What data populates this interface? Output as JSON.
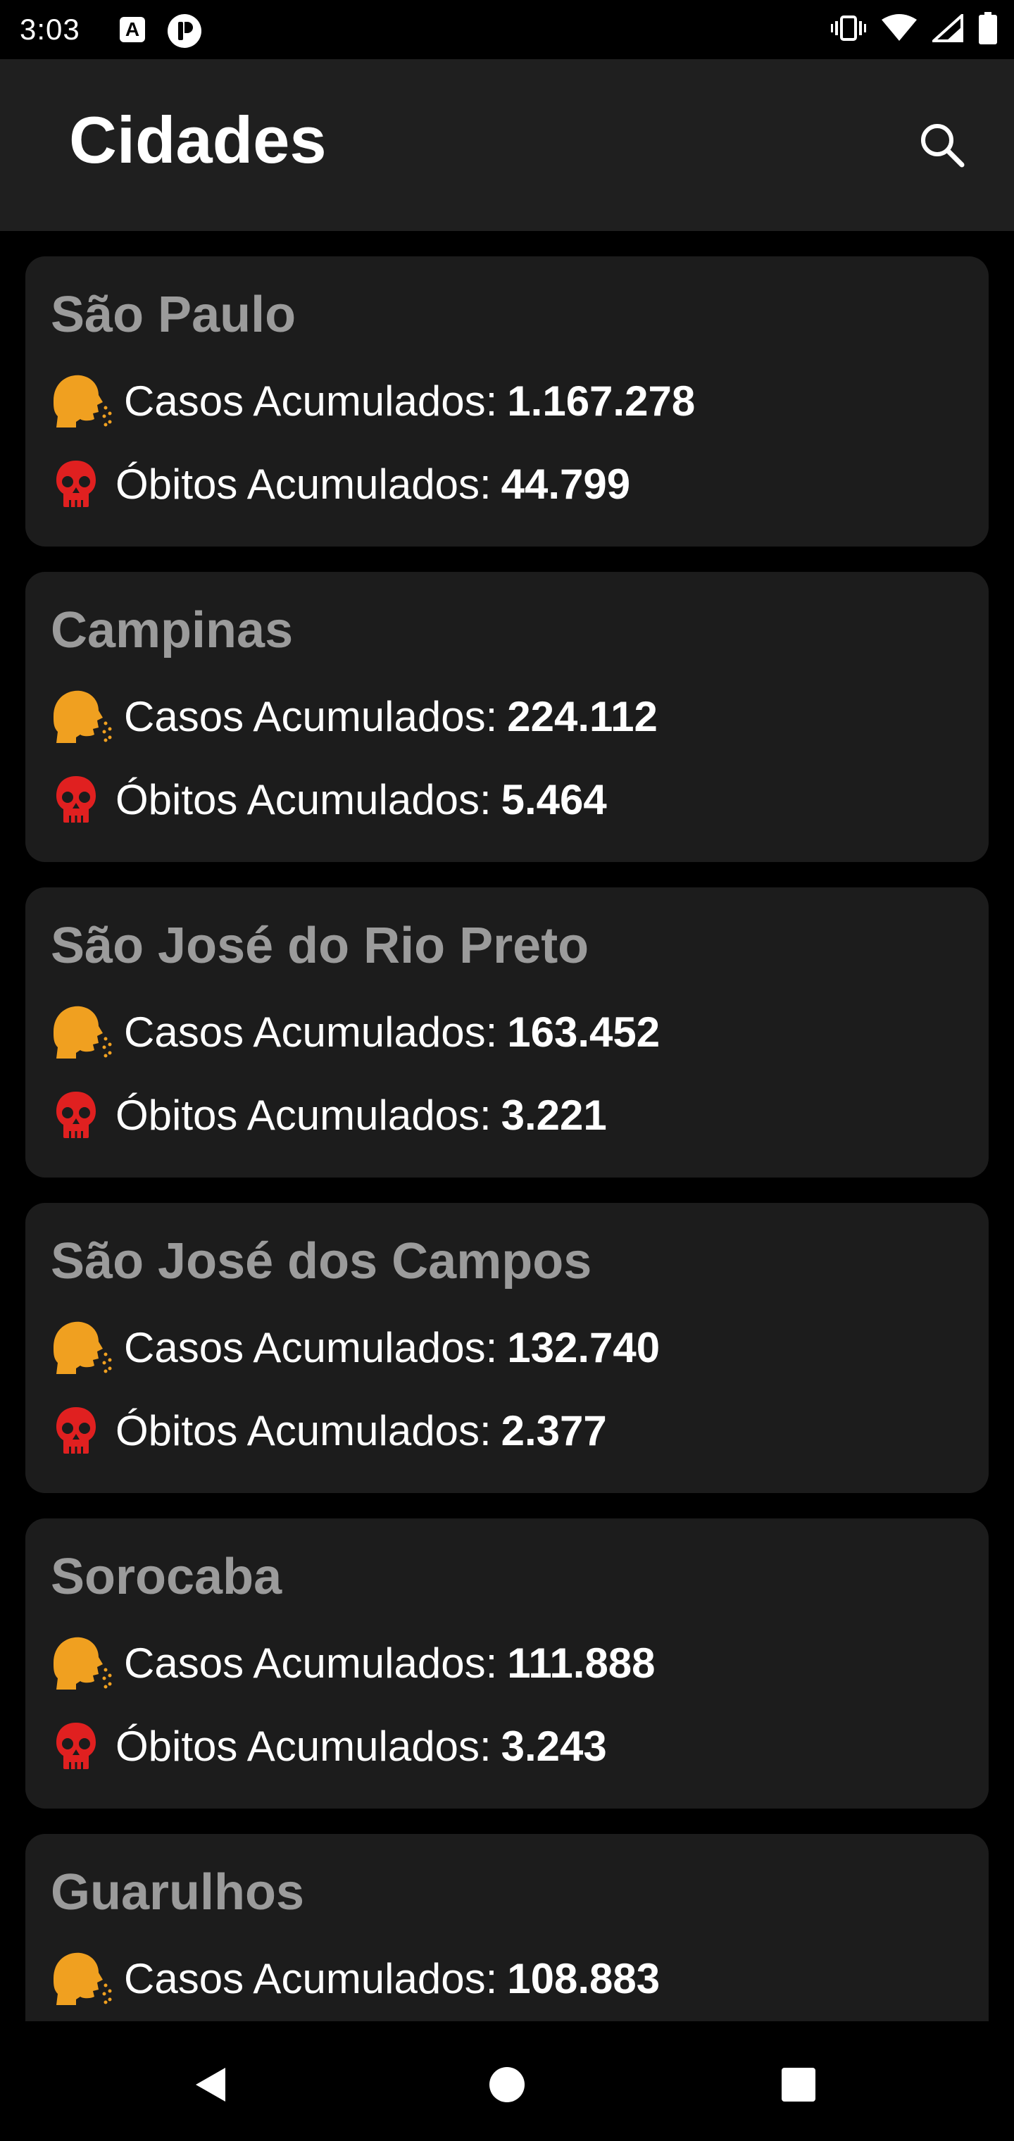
{
  "status_bar": {
    "time": "3:03",
    "a_badge": "A",
    "icons": [
      "vibrate-icon",
      "wifi-icon",
      "signal-icon",
      "battery-icon"
    ]
  },
  "app_bar": {
    "title": "Cidades",
    "search_icon": "search-icon"
  },
  "colors": {
    "background": "#000000",
    "app_bar": "#1f1f1f",
    "card": "#1c1c1c",
    "city_name": "#9b9b9b",
    "cases_icon": "#f0a020",
    "deaths_icon": "#e02020"
  },
  "cities": [
    {
      "name": "São Paulo",
      "cases_label": "Casos Acumulados:",
      "cases": "1.167.278",
      "deaths_label": "Óbitos Acumulados:",
      "deaths": "44.799"
    },
    {
      "name": "Campinas",
      "cases_label": "Casos Acumulados:",
      "cases": "224.112",
      "deaths_label": "Óbitos Acumulados:",
      "deaths": "5.464"
    },
    {
      "name": "São José do Rio Preto",
      "cases_label": "Casos Acumulados:",
      "cases": "163.452",
      "deaths_label": "Óbitos Acumulados:",
      "deaths": "3.221"
    },
    {
      "name": "São José dos Campos",
      "cases_label": "Casos Acumulados:",
      "cases": "132.740",
      "deaths_label": "Óbitos Acumulados:",
      "deaths": "2.377"
    },
    {
      "name": "Sorocaba",
      "cases_label": "Casos Acumulados:",
      "cases": "111.888",
      "deaths_label": "Óbitos Acumulados:",
      "deaths": "3.243"
    },
    {
      "name": "Guarulhos",
      "cases_label": "Casos Acumulados:",
      "cases": "108.883"
    }
  ],
  "nav_bar": {
    "back_icon": "back-triangle-icon",
    "home_icon": "home-circle-icon",
    "recents_icon": "recents-square-icon"
  }
}
